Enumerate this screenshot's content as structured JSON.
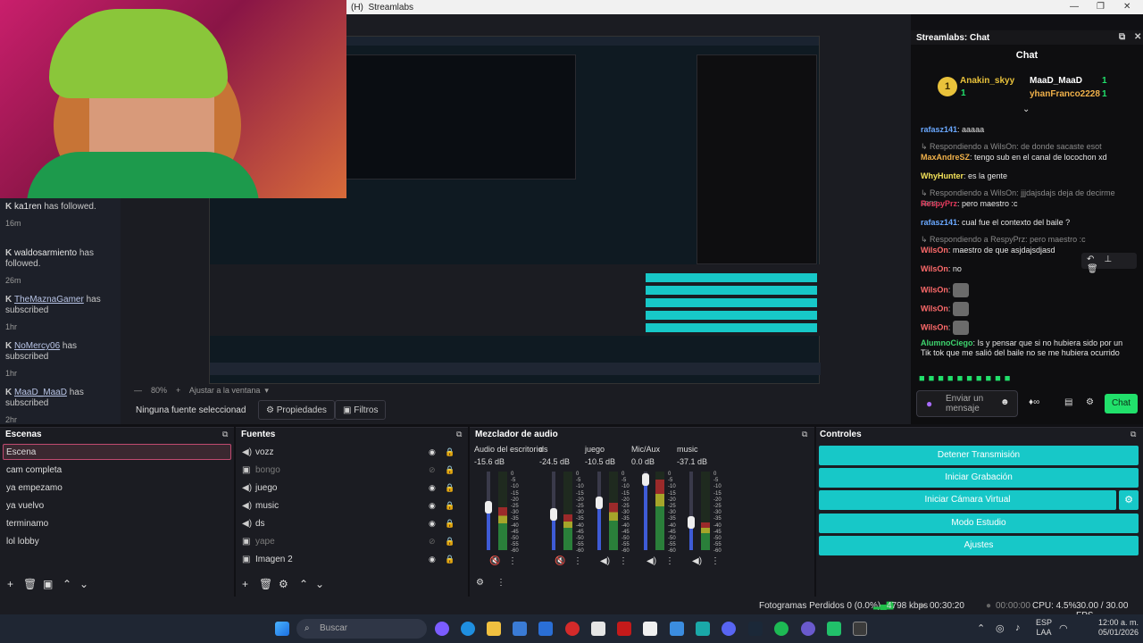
{
  "window": {
    "title": "Streamlabs",
    "badge": "(H)"
  },
  "activity": [
    {
      "name": "ka1ren",
      "linked": false,
      "action": "has followed.",
      "time": "16m"
    },
    {
      "name": "waldosarmiento",
      "linked": false,
      "action": "has followed.",
      "time": "26m"
    },
    {
      "name": "TheMaznaGamer",
      "linked": true,
      "action": "has subscribed",
      "time": "1hr"
    },
    {
      "name": "NoMercy06",
      "linked": true,
      "action": "has subscribed",
      "time": "1hr"
    },
    {
      "name": "MaaD_MaaD",
      "linked": true,
      "action": "has subscribed",
      "time": "2hr"
    }
  ],
  "preview": {
    "zoom": "80%",
    "fit_label": "Ajustar a la ventana",
    "no_source": "Ninguna fuente seleccionad",
    "properties": "Propiedades",
    "filters": "Filtros"
  },
  "chat": {
    "window_title": "Streamlabs: Chat",
    "title": "Chat",
    "leaders": [
      {
        "name": "Anakin_skyy",
        "count": "1"
      },
      {
        "name": "MaaD_MaaD",
        "count": "1"
      },
      {
        "name": "yhanFranco2228",
        "count": "1"
      }
    ],
    "messages": [
      {
        "user": "rafasz141",
        "text": ": aaaaa",
        "color": "#6aa8ff"
      },
      {
        "reply": "Respondiendo a WilsOn: de donde sacaste esot"
      },
      {
        "user": "MaxAndreSZ",
        "text": ": tengo sub en el canal de locochon xd",
        "color": "#f0b14a"
      },
      {
        "user": "WhyHunter",
        "text": ": es la gente",
        "color": "#f5e35a"
      },
      {
        "reply": "Respondiendo a WilsOn: jjjdajsdajs deja de decirme sens..."
      },
      {
        "user": "RespyPrz",
        "text": ": pero maestro :c",
        "color": "#e0385a"
      },
      {
        "user": "rafasz141",
        "text": ": cual fue el contexto del baile ?",
        "color": "#6aa8ff"
      },
      {
        "reply": "Respondiendo a RespyPrz: pero maestro :c"
      },
      {
        "user": "WilsOn",
        "text": ": maestro de que asjdajsdjasd",
        "color": "#ff6b6b"
      },
      {
        "user": "WilsOn",
        "text": ": no",
        "color": "#ff6b6b"
      },
      {
        "user": "WilsOn",
        "text": ":",
        "color": "#ff6b6b",
        "emote": true
      },
      {
        "user": "WilsOn",
        "text": ":",
        "color": "#ff6b6b",
        "emote": true
      },
      {
        "user": "WilsOn",
        "text": ":",
        "color": "#ff6b6b",
        "emote": true
      },
      {
        "user": "AlumnoCiego",
        "text": ": Is y pensar que si no hubiera sido por un Tik tok que me salió del baile no se me hubiera ocurrido",
        "color": "#3ed46e"
      }
    ],
    "input_placeholder": "Enviar un mensaje",
    "send_label": "Chat"
  },
  "scenes": {
    "title": "Escenas",
    "items": [
      "Escena",
      "cam completa",
      "ya empezamo",
      "ya vuelvo",
      "terminamo",
      "lol lobby"
    ],
    "selected": 0
  },
  "sources": {
    "title": "Fuentes",
    "items": [
      {
        "name": "vozz",
        "icon": "speaker-icon",
        "visible": true
      },
      {
        "name": "bongo",
        "icon": "image-icon",
        "visible": false
      },
      {
        "name": "juego",
        "icon": "speaker-icon",
        "visible": true
      },
      {
        "name": "music",
        "icon": "speaker-icon",
        "visible": true
      },
      {
        "name": "ds",
        "icon": "speaker-icon",
        "visible": true
      },
      {
        "name": "yape",
        "icon": "image-icon",
        "visible": false
      },
      {
        "name": "Imagen 2",
        "icon": "image-icon",
        "visible": true
      }
    ]
  },
  "mixer": {
    "title": "Mezclador de audio",
    "channels": [
      {
        "name": "Audio del escritorio",
        "db": "-15.6 dB",
        "level": 0.55,
        "muted": true
      },
      {
        "name": "ds",
        "db": "-24.5 dB",
        "level": 0.45,
        "muted": true
      },
      {
        "name": "juego",
        "db": "-10.5 dB",
        "level": 0.6,
        "muted": false
      },
      {
        "name": "Mic/Aux",
        "db": "0.0 dB",
        "level": 0.9,
        "muted": false
      },
      {
        "name": "music",
        "db": "-37.1 dB",
        "level": 0.35,
        "muted": false
      }
    ],
    "scale": [
      "0",
      "-5",
      "-10",
      "-15",
      "-20",
      "-25",
      "-30",
      "-35",
      "-40",
      "-45",
      "-50",
      "-55",
      "-60"
    ]
  },
  "controls": {
    "title": "Controles",
    "buttons": [
      "Detener Transmisión",
      "Iniciar Grabación",
      "Iniciar Cámara Virtual",
      "Modo Estudio",
      "Ajustes"
    ],
    "accent": "#17c8c8"
  },
  "status": {
    "frames": "Fotogramas Perdidos 0 (0.0%)",
    "bitrate": "4798 kbps",
    "stream_time": "00:30:20",
    "rec_time": "00:00:00",
    "cpu": "CPU: 4.5%",
    "fps": "30.00 / 30.00 FPS"
  },
  "taskbar": {
    "search": "Buscar",
    "lang": "ESP",
    "lang2": "LAA",
    "time": "12:00 a. m.",
    "date": "05/01/2026"
  }
}
